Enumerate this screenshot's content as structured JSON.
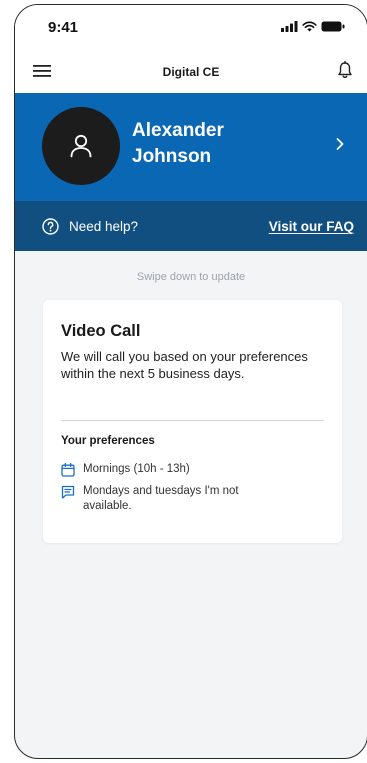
{
  "status_bar": {
    "time": "9:41"
  },
  "nav": {
    "title": "Digital CE"
  },
  "profile": {
    "name": "Alexander Johnson"
  },
  "help": {
    "text": "Need help?",
    "link": "Visit our FAQ"
  },
  "swipe_hint": "Swipe down to update",
  "card": {
    "title": "Video Call",
    "description": "We will call you based on your preferences within the next 5 business days.",
    "preferences_heading": "Your preferences",
    "preferences": [
      {
        "icon": "calendar-icon",
        "text": "Mornings (10h - 13h)"
      },
      {
        "icon": "message-icon",
        "text": "Mondays and tuesdays I'm not available."
      }
    ]
  },
  "colors": {
    "banner_blue": "#0967b3",
    "help_strip_blue": "#114f80",
    "icon_blue": "#1a6fc4",
    "background": "#f3f4f6"
  }
}
